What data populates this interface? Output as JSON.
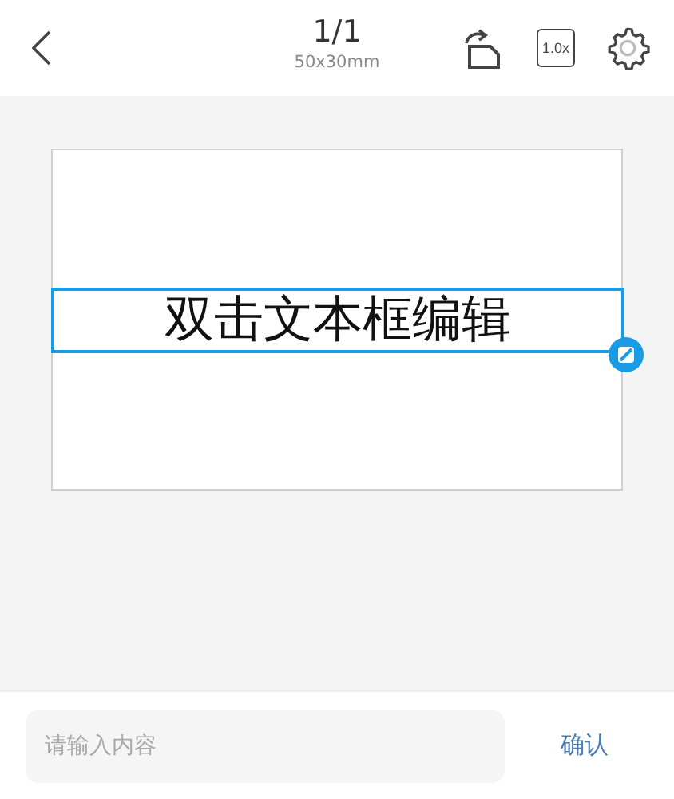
{
  "header": {
    "page": "1/1",
    "size": "50x30mm",
    "zoom_label": "1.0x"
  },
  "label": {
    "text": "双击文本框编辑",
    "selected": true
  },
  "input": {
    "placeholder": "请输入内容"
  },
  "confirm": "确认"
}
